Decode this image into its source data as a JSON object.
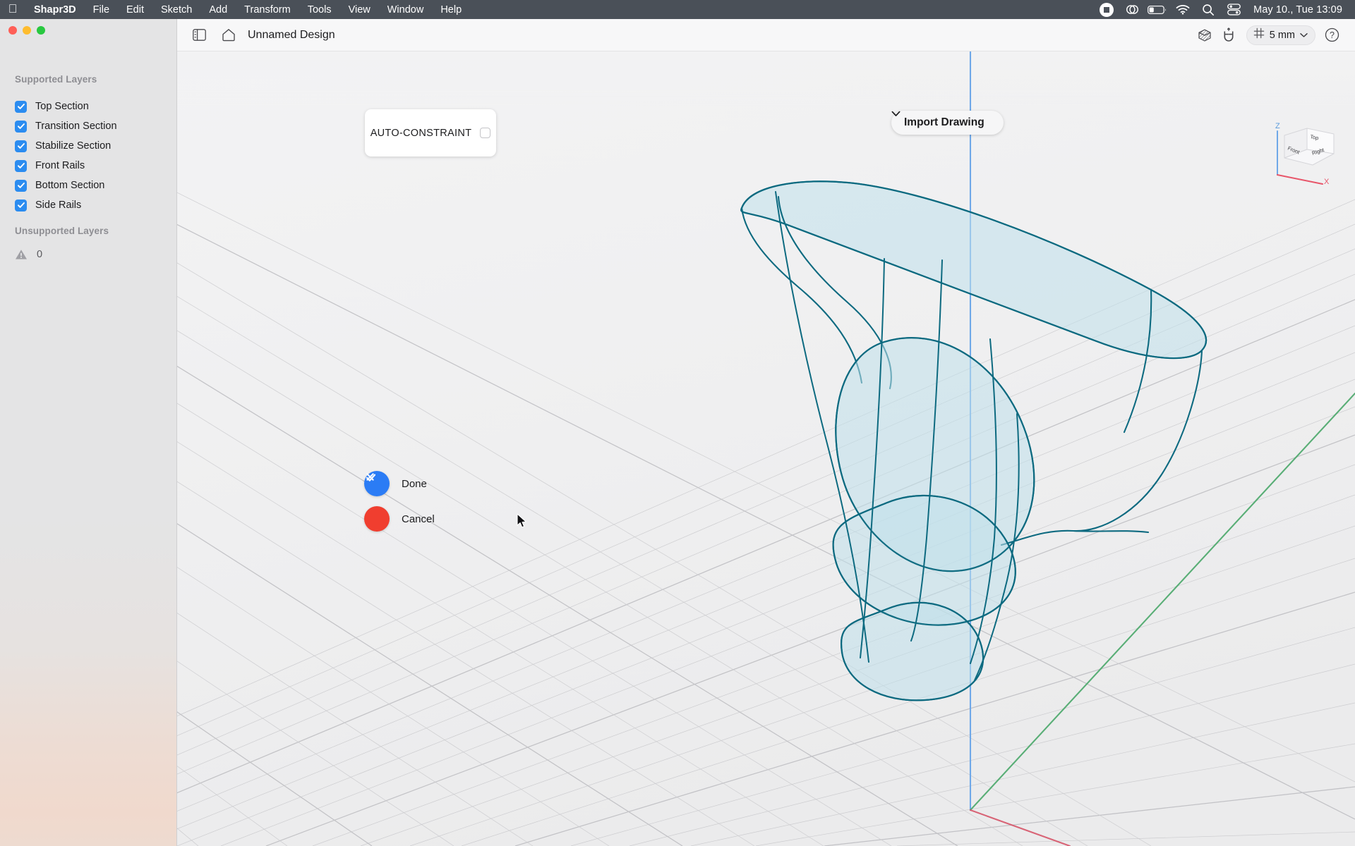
{
  "menubar": {
    "apple_icon": "apple-logo-icon",
    "app_name": "Shapr3D",
    "items": [
      "File",
      "Edit",
      "Sketch",
      "Add",
      "Transform",
      "Tools",
      "View",
      "Window",
      "Help"
    ],
    "status_icons": [
      "screen-record-icon",
      "creative-cloud-icon",
      "battery-icon",
      "wifi-icon",
      "spotlight-search-icon",
      "control-center-icon"
    ],
    "clock": "May 10., Tue  13:09",
    "bar_color": "#4a5058"
  },
  "window_controls": {
    "close": "close-window-button",
    "minimize": "minimize-window-button",
    "zoom": "zoom-window-button"
  },
  "toolbar": {
    "sidebar_toggle_icon": "sidebar-toggle-icon",
    "home_icon": "home-icon",
    "document_title": "Unnamed Design",
    "body_visibility_icon": "shaded-body-icon",
    "snap_icon": "magnet-snap-icon",
    "grid_icon": "grid-icon",
    "grid_value": "5 mm",
    "grid_chevron_icon": "chevron-down-icon",
    "help_icon": "help-question-icon"
  },
  "sidebar": {
    "supported_heading": "Supported Layers",
    "layers": [
      {
        "label": "Top Section",
        "checked": true
      },
      {
        "label": "Transition Section",
        "checked": true
      },
      {
        "label": "Stabilize Section",
        "checked": true
      },
      {
        "label": "Front Rails",
        "checked": true
      },
      {
        "label": "Bottom Section",
        "checked": true
      },
      {
        "label": "Side Rails",
        "checked": true
      }
    ],
    "unsupported_heading": "Unsupported Layers",
    "unsupported_icon": "warning-triangle-icon",
    "unsupported_count": "0",
    "checkbox_color": "#2b8cf0"
  },
  "viewport": {
    "auto_constraint": {
      "label": "AUTO-CONSTRAINT",
      "checked": false,
      "checkbox_name": "auto-constraint-checkbox"
    },
    "import_drawing": {
      "label": "Import Drawing",
      "chevron_icon": "chevron-down-icon"
    },
    "actions": [
      {
        "label": "Done",
        "icon": "checkmark-icon",
        "color": "#2b7cf5"
      },
      {
        "label": "Cancel",
        "icon": "cross-x-icon",
        "color": "#f03e2f"
      }
    ],
    "nav_cube": {
      "faces": [
        "Top",
        "Front",
        "Right"
      ],
      "axis_labels": [
        "Z",
        "X"
      ],
      "z_axis_color": "#4a90e2",
      "x_axis_color": "#e8566a"
    },
    "axes": {
      "z_color": "#6fa8e8",
      "y_color": "#4aa86a",
      "x_color": "#d6566a"
    },
    "sketch": {
      "fill_color": "#bfe0eb",
      "stroke_color": "#0d6a80",
      "grid_color": "#c9c9cc"
    },
    "cursor_icon": "mouse-pointer-icon"
  }
}
